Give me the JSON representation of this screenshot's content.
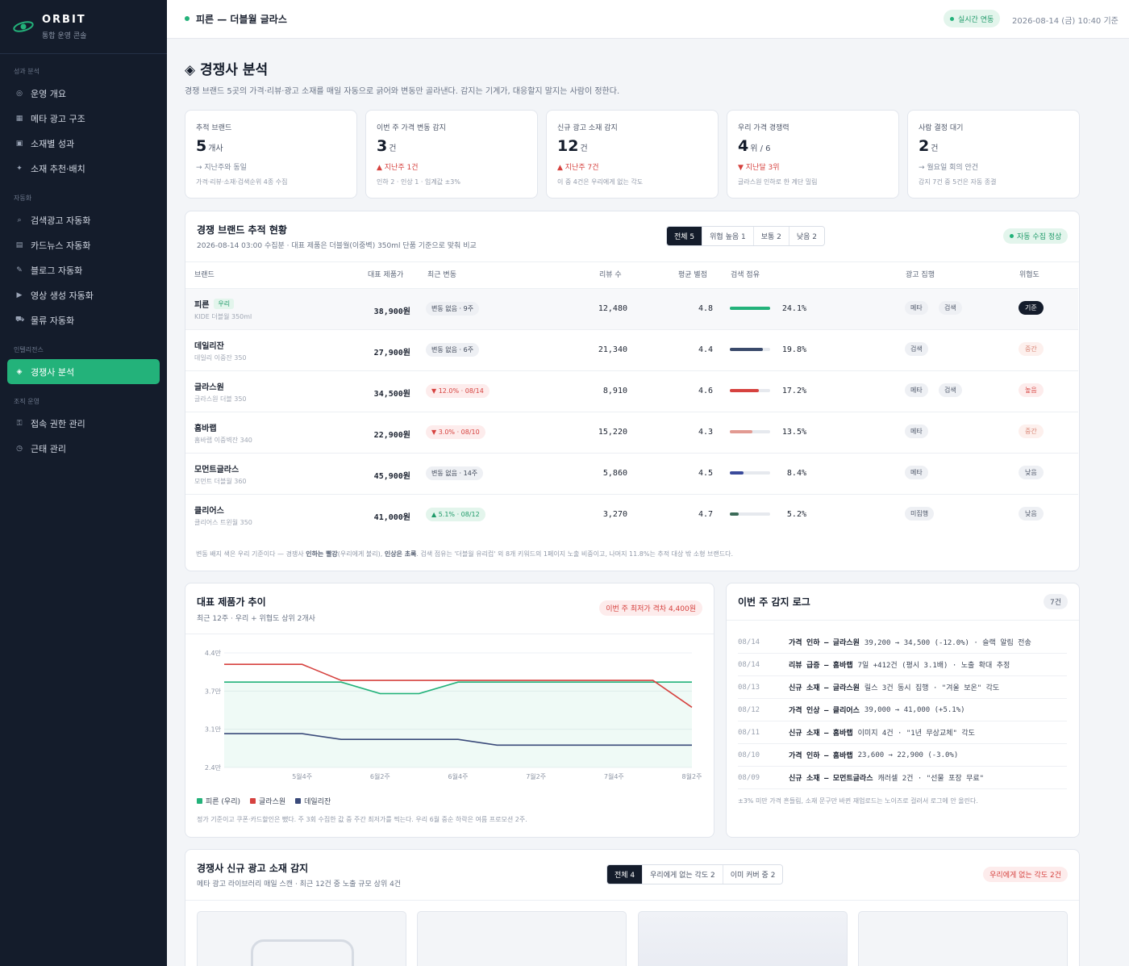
{
  "app": {
    "name": "ORBIT",
    "subtitle": "통합 운영 콘솔"
  },
  "sidebar": {
    "sections": [
      {
        "label": "성과 분석",
        "items": [
          {
            "label": "운영 개요",
            "icon": "radar-icon"
          },
          {
            "label": "메타 광고 구조",
            "icon": "grid-icon"
          },
          {
            "label": "소재별 성과",
            "icon": "square-icon"
          },
          {
            "label": "소재 추천·배치",
            "icon": "sparkle-icon"
          }
        ]
      },
      {
        "label": "자동화",
        "items": [
          {
            "label": "검색광고 자동화",
            "icon": "search-icon"
          },
          {
            "label": "카드뉴스 자동화",
            "icon": "cards-icon"
          },
          {
            "label": "블로그 자동화",
            "icon": "pen-icon"
          },
          {
            "label": "영상 생성 자동화",
            "icon": "play-icon"
          },
          {
            "label": "물류 자동화",
            "icon": "truck-icon"
          }
        ]
      },
      {
        "label": "인텔리전스",
        "items": [
          {
            "label": "경쟁사 분석",
            "icon": "diamond-icon",
            "active": true
          }
        ]
      },
      {
        "label": "조직 운영",
        "items": [
          {
            "label": "접속 권한 관리",
            "icon": "key-icon"
          },
          {
            "label": "근태 관리",
            "icon": "clock-icon"
          }
        ]
      }
    ]
  },
  "topbar": {
    "title": "피른 — 더블월 글라스",
    "live": "실시간 연동",
    "timestamp": "2026-08-14 (금) 10:40 기준"
  },
  "page": {
    "title": "◈ 경쟁사 분석",
    "description": "경쟁 브랜드 5곳의 가격·리뷰·광고 소재를 매일 자동으로 긁어와 변동만 골라낸다. 감지는 기계가, 대응할지 말지는 사람이 정한다."
  },
  "kpis": [
    {
      "label": "추적 브랜드",
      "value": "5",
      "unit": "개사",
      "delta": "→ 지난주와 동일",
      "delta_tone": "neutral",
      "note": "가격·리뷰·소재·검색순위 4종 수집"
    },
    {
      "label": "이번 주 가격 변동 감지",
      "value": "3",
      "unit": "건",
      "delta": "▲ 지난주 1건",
      "delta_tone": "red",
      "note": "인하 2 · 인상 1 · 임계값 ±3%"
    },
    {
      "label": "신규 광고 소재 감지",
      "value": "12",
      "unit": "건",
      "delta": "▲ 지난주 7건",
      "delta_tone": "red",
      "note": "이 중 4건은 우리에게 없는 각도"
    },
    {
      "label": "우리 가격 경쟁력",
      "value": "4",
      "unit": "위 / 6",
      "delta": "▼ 지난달 3위",
      "delta_tone": "red",
      "note": "글라스원 인하로 한 계단 밀림"
    },
    {
      "label": "사람 결정 대기",
      "value": "2",
      "unit": "건",
      "delta": "→ 월요일 회의 안건",
      "delta_tone": "neutral",
      "note": "감지 7건 중 5건은 자동 종결"
    }
  ],
  "tracking": {
    "title": "경쟁 브랜드 추적 현황",
    "subtitle": "2026-08-14 03:00 수집분 · 대표 제품은 더블월(이중벽) 350ml 단품 기준으로 맞춰 비교",
    "filters": [
      "전체 5",
      "위협 높음 1",
      "보통 2",
      "낮음 2"
    ],
    "status": "자동 수집 정상",
    "columns": [
      "브랜드",
      "대표 제품가",
      "최근 변동",
      "리뷰 수",
      "평균 별점",
      "검색 점유",
      "광고 집행",
      "위협도"
    ],
    "rows": [
      {
        "brand": "피른",
        "ours_tag": "우리",
        "product": "KIDE 더블월 350ml",
        "price": "38,900원",
        "change": "변동 없음 · 9주",
        "change_tone": "n",
        "reviews": "12,480",
        "rating": "4.8",
        "share": "24.1%",
        "share_value": 24.1,
        "share_color": "#23b27a",
        "ads": [
          "메타",
          "검색"
        ],
        "risk": "기준",
        "risk_tone": "base"
      },
      {
        "brand": "데일리잔",
        "product": "데일리 이중잔 350",
        "price": "27,900원",
        "change": "변동 없음 · 6주",
        "change_tone": "n",
        "reviews": "21,340",
        "rating": "4.4",
        "share": "19.8%",
        "share_value": 19.8,
        "share_color": "#3a4a6b",
        "ads": [
          "검색"
        ],
        "risk": "중간",
        "risk_tone": "mid"
      },
      {
        "brand": "글라스원",
        "product": "글라스원 더블 350",
        "price": "34,500원",
        "change": "▼ 12.0% · 08/14",
        "change_tone": "r",
        "reviews": "8,910",
        "rating": "4.6",
        "share": "17.2%",
        "share_value": 17.2,
        "share_color": "#d6423f",
        "ads": [
          "메타",
          "검색"
        ],
        "risk": "높음",
        "risk_tone": "high"
      },
      {
        "brand": "홈바랩",
        "product": "홈바랩 이중벽잔 340",
        "price": "22,900원",
        "change": "▼ 3.0% · 08/10",
        "change_tone": "r",
        "reviews": "15,220",
        "rating": "4.3",
        "share": "13.5%",
        "share_value": 13.5,
        "share_color": "#e29a92",
        "ads": [
          "메타"
        ],
        "risk": "중간",
        "risk_tone": "mid"
      },
      {
        "brand": "모먼트글라스",
        "product": "모먼트 더블월 360",
        "price": "45,900원",
        "change": "변동 없음 · 14주",
        "change_tone": "n",
        "reviews": "5,860",
        "rating": "4.5",
        "share": "8.4%",
        "share_value": 8.4,
        "share_color": "#3a4a9b",
        "ads": [
          "메타"
        ],
        "risk": "낮음",
        "risk_tone": "low"
      },
      {
        "brand": "클리어스",
        "product": "클리어스 트윈월 350",
        "price": "41,000원",
        "change": "▲ 5.1% · 08/12",
        "change_tone": "g",
        "reviews": "3,270",
        "rating": "4.7",
        "share": "5.2%",
        "share_value": 5.2,
        "share_color": "#3b6b58",
        "ads": [
          "미집행"
        ],
        "risk": "낮음",
        "risk_tone": "low"
      }
    ],
    "note_pre": "변동 배지 색은 우리 기준이다 — 경쟁사 ",
    "note_b1": "인하는 빨강",
    "note_mid": "(우리에게 불리), ",
    "note_b2": "인상은 초록",
    "note_post": ". 검색 점유는 '더블월 유리컵' 외 8개 키워드의 1페이지 노출 비중이고, 나머지 11.8%는 추적 대상 밖 소형 브랜드다."
  },
  "price_trend": {
    "title": "대표 제품가 추이",
    "subtitle": "최근 12주 · 우리 + 위협도 상위 2개사",
    "badge": "이번 주 최저가 격차 4,400원",
    "note": "정가 기준이고 쿠폰·카드할인은 뺐다. 주 3회 수집한 값 중 주간 최저가를 찍는다. 우리 6월 중순 하락은 여름 프로모션 2주."
  },
  "chart_data": {
    "type": "line",
    "x": [
      "5월2주",
      "5월3주",
      "5월4주",
      "6월1주",
      "6월2주",
      "6월3주",
      "6월4주",
      "7월1주",
      "7월2주",
      "7월3주",
      "7월4주",
      "8월1주",
      "8월2주"
    ],
    "tick_labels": [
      "5월4주",
      "6월2주",
      "6월4주",
      "7월2주",
      "7월4주",
      "8월2주"
    ],
    "y_tick_labels": [
      "2.4만",
      "3.1만",
      "3.7만",
      "4.4만"
    ],
    "ylim": [
      24000,
      44000
    ],
    "series": [
      {
        "name": "피른 (우리)",
        "color": "#23b27a",
        "fill": true,
        "values": [
          38900,
          38900,
          38900,
          38900,
          36900,
          36900,
          38900,
          38900,
          38900,
          38900,
          38900,
          38900,
          38900
        ]
      },
      {
        "name": "글라스원",
        "color": "#d6423f",
        "values": [
          42000,
          42000,
          42000,
          39200,
          39200,
          39200,
          39200,
          39200,
          39200,
          39200,
          39200,
          39200,
          34500
        ]
      },
      {
        "name": "데일리잔",
        "color": "#3a4a7a",
        "values": [
          29900,
          29900,
          29900,
          28900,
          28900,
          28900,
          28900,
          27900,
          27900,
          27900,
          27900,
          27900,
          27900
        ]
      }
    ]
  },
  "log": {
    "title": "이번 주 감지 로그",
    "count": "7건",
    "entries": [
      {
        "date": "08/14",
        "kind": "가격 인하 — 글라스원",
        "text": "39,200 → 34,500 (-12.0%) · 슬랙 알림 전송"
      },
      {
        "date": "08/14",
        "kind": "리뷰 급증 — 홈바랩",
        "text": "7일 +412건 (평시 3.1배) · 노출 확대 추정"
      },
      {
        "date": "08/13",
        "kind": "신규 소재 — 글라스원",
        "text": "릴스 3건 동시 집행 · \"겨울 보온\" 각도"
      },
      {
        "date": "08/12",
        "kind": "가격 인상 — 클리어스",
        "text": "39,000 → 41,000 (+5.1%)"
      },
      {
        "date": "08/11",
        "kind": "신규 소재 — 홈바랩",
        "text": "이미지 4건 · \"1년 무상교체\" 각도"
      },
      {
        "date": "08/10",
        "kind": "가격 인하 — 홈바랩",
        "text": "23,600 → 22,900 (-3.0%)"
      },
      {
        "date": "08/09",
        "kind": "신규 소재 — 모먼트글라스",
        "text": "캐러셀 2건 · \"선물 포장 무료\""
      }
    ],
    "note": "±3% 미만 가격 흔들림, 소재 문구만 바뀐 재업로드는 노이즈로 걸러서 로그에 안 올린다."
  },
  "creatives": {
    "title": "경쟁사 신규 광고 소재 감지",
    "subtitle": "메타 광고 라이브러리 매일 스캔 · 최근 12건 중 노출 규모 상위 4건",
    "filters": [
      "전체 4",
      "우리에게 없는 각도 2",
      "이미 커버 중 2"
    ],
    "badge": "우리에게 없는 각도 2건"
  }
}
